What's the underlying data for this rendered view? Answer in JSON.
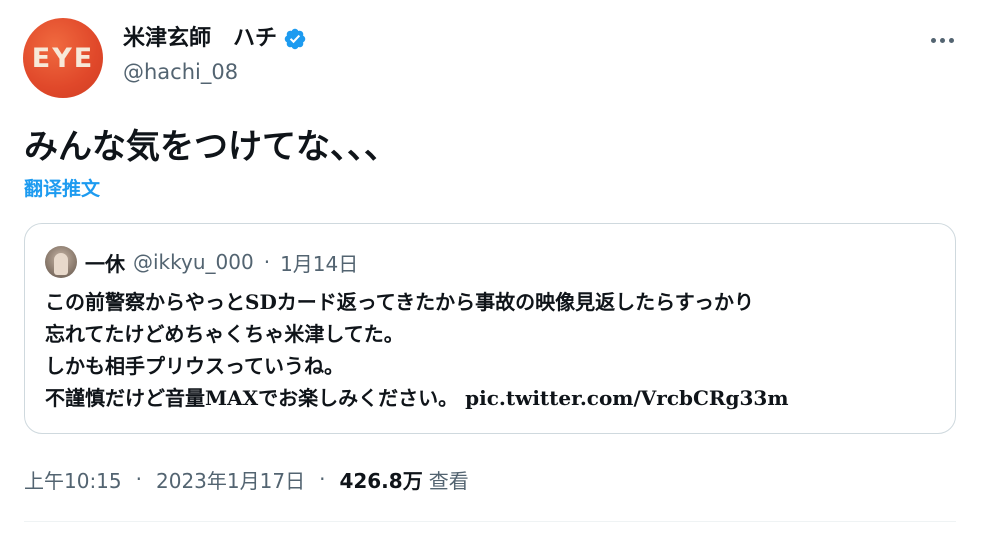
{
  "author": {
    "display_name": "米津玄師　ハチ",
    "handle": "@hachi_08",
    "avatar_text": "EYE",
    "verified": true
  },
  "tweet": {
    "text": "みんな気をつけてな、、、",
    "translate_label": "翻译推文"
  },
  "quote": {
    "name": "一休",
    "handle": "@ikkyu_000",
    "separator": "·",
    "date": "1月14日",
    "lines": [
      "この前警察からやっとSDカード返ってきたから事故の映像見返したらすっかり",
      "忘れてたけどめちゃくちゃ米津してた。",
      "しかも相手プリウスっていうね。",
      "不謹慎だけど音量MAXでお楽しみください。 pic.twitter.com/VrcbCRg33m"
    ]
  },
  "meta": {
    "time": "上午10:15",
    "separator": "·",
    "date": "2023年1月17日",
    "views_count": "426.8万",
    "views_label": "查看"
  },
  "icons": {
    "more": "more-horizontal-icon",
    "verified": "verified-badge-icon"
  },
  "colors": {
    "accent": "#1d9bf0",
    "secondary_text": "#536471",
    "border": "#cfd9de",
    "avatar_bg": "#e0482a"
  }
}
